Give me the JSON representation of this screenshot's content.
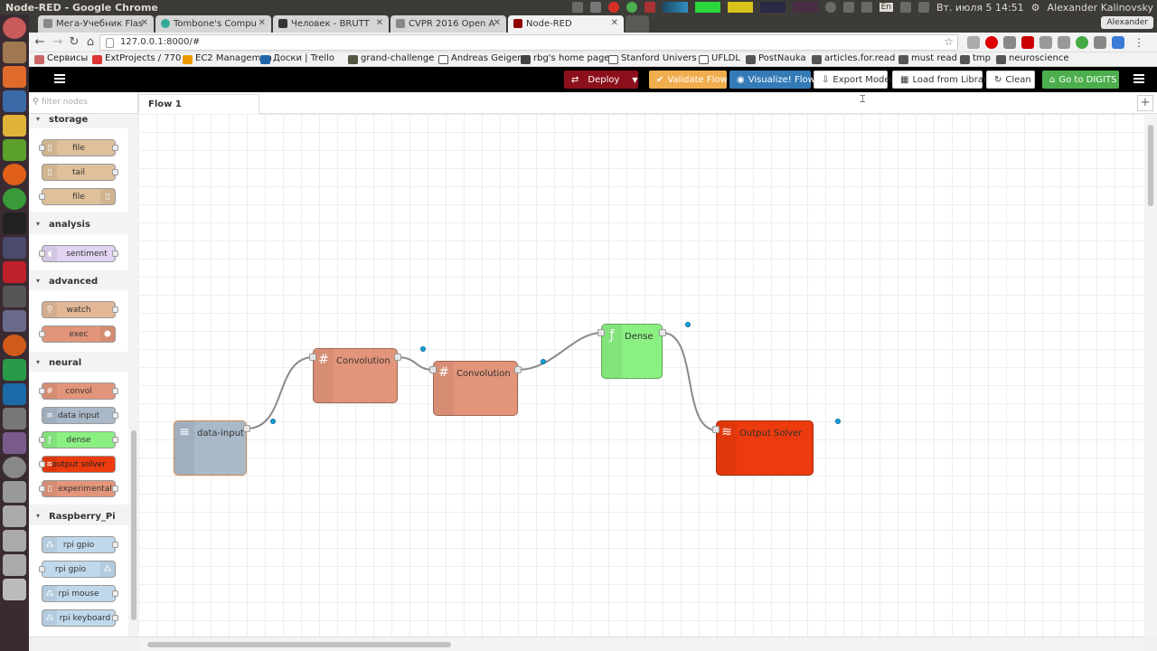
{
  "os": {
    "window_title": "Node-RED - Google Chrome",
    "clock": "Вт. июля  5 14:51",
    "user": "Alexander Kalinovsky",
    "lang": "En"
  },
  "browser": {
    "tabs": [
      {
        "label": "Мега-Учебник Flas",
        "color": "#888"
      },
      {
        "label": "Tombone's Compu",
        "color": "#3a9"
      },
      {
        "label": "Человек - BRUTT",
        "color": "#333"
      },
      {
        "label": "CVPR 2016 Open A",
        "color": "#888"
      },
      {
        "label": "Node-RED",
        "color": "#8f0000"
      }
    ],
    "profile": "Alexander",
    "url": "127.0.0.1:8000/#",
    "bookmarks": [
      "Сервисы",
      "ExtProjects / 770",
      "EC2 Managemen",
      "Доски | Trello",
      "grand-challenge",
      "Andreas Geiger",
      "rbg's home page",
      "Stanford Univers",
      "UFLDL",
      "PostNauka",
      "articles.for.read",
      "must read",
      "tmp",
      "neuroscience"
    ]
  },
  "header": {
    "deploy": "Deploy",
    "validate": "Validate Flow",
    "visualize": "Visualize! Flow",
    "export": "Export Model",
    "load": "Load from Library",
    "clean": "Clean",
    "digits": "Go to DIGITS"
  },
  "palette": {
    "search_placeholder": "filter nodes",
    "categories": {
      "storage": {
        "title": "storage",
        "nodes": [
          "file",
          "tail",
          "file"
        ]
      },
      "analysis": {
        "title": "analysis",
        "nodes": [
          "sentiment"
        ]
      },
      "advanced": {
        "title": "advanced",
        "nodes": [
          "watch",
          "exec"
        ]
      },
      "neural": {
        "title": "neural",
        "nodes": [
          "convol",
          "data input",
          "dense",
          "output solver",
          "experimental"
        ]
      },
      "raspberry": {
        "title": "Raspberry_Pi",
        "nodes": [
          "rpi gpio",
          "rpi gpio",
          "rpi mouse",
          "rpi keyboard"
        ]
      }
    }
  },
  "workspace": {
    "tab": "Flow 1",
    "nodes": {
      "data_input": "data-input",
      "conv1": "Convolution",
      "conv2": "Convolution",
      "dense": "Dense",
      "output": "Output Solver"
    }
  },
  "colors": {
    "storage": "#dec09a",
    "sentiment": "#e2d4f3",
    "advanced": "#e2b797",
    "convol": "#e2957a",
    "data_input": "#a9b9c8",
    "dense": "#8bf082",
    "output": "#ec3b0e",
    "experimental": "#e2957a",
    "rpi": "#c0d8eb"
  }
}
